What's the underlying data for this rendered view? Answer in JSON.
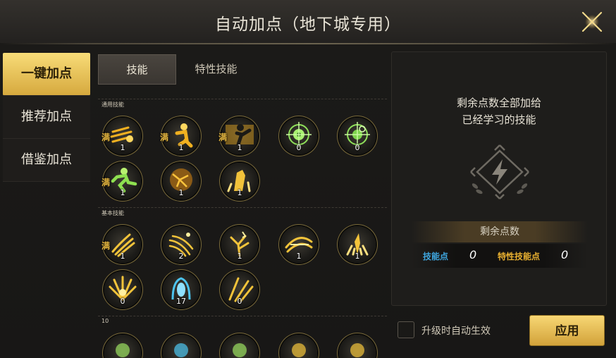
{
  "window": {
    "title": "自动加点（地下城专用）"
  },
  "sidebar": {
    "items": [
      {
        "label": "一键加点",
        "active": true
      },
      {
        "label": "推荐加点",
        "active": false
      },
      {
        "label": "借鉴加点",
        "active": false
      }
    ]
  },
  "tabs": [
    {
      "label": "技能",
      "active": true
    },
    {
      "label": "特性技能",
      "active": false
    }
  ],
  "sections": {
    "common": {
      "title": "通用技能",
      "skills": [
        {
          "icon": "dash-icon",
          "maxed": "满",
          "level": "1"
        },
        {
          "icon": "crouch-icon",
          "maxed": "满",
          "level": "1"
        },
        {
          "icon": "kick-icon",
          "maxed": "满",
          "level": "1"
        },
        {
          "icon": "target-icon",
          "maxed": "",
          "level": "0"
        },
        {
          "icon": "target-swirl-icon",
          "maxed": "",
          "level": "0"
        },
        {
          "icon": "sprint-icon",
          "maxed": "满",
          "level": "1"
        },
        {
          "icon": "cracked-orb-icon",
          "maxed": "",
          "level": "1"
        },
        {
          "icon": "rock-burst-icon",
          "maxed": "",
          "level": "1"
        }
      ]
    },
    "basic": {
      "title": "基本技能",
      "skills": [
        {
          "icon": "claw-slash-icon",
          "maxed": "满",
          "level": "1"
        },
        {
          "icon": "wind-slash-icon",
          "maxed": "",
          "level": "2"
        },
        {
          "icon": "lightning-tree-icon",
          "maxed": "",
          "level": "1"
        },
        {
          "icon": "whirl-slash-icon",
          "maxed": "",
          "level": "1"
        },
        {
          "icon": "flame-burst-icon",
          "maxed": "",
          "level": "1"
        },
        {
          "icon": "explosion-icon",
          "maxed": "",
          "level": "0"
        },
        {
          "icon": "blue-spirit-icon",
          "maxed": "",
          "level": "17"
        },
        {
          "icon": "triple-slash-icon",
          "maxed": "",
          "level": "0"
        }
      ]
    },
    "lv10": {
      "title": "10"
    }
  },
  "right_panel": {
    "description_line1": "剩余点数全部加给",
    "description_line2": "已经学习的技能",
    "emblem_icon": "lightning-emblem-icon",
    "remaining_title": "剩余点数",
    "skill_points_label": "技能点",
    "skill_points_value": "0",
    "trait_points_label": "特性技能点",
    "trait_points_value": "0"
  },
  "footer": {
    "auto_apply_label": "升级时自动生效",
    "auto_apply_checked": false,
    "apply_label": "应用"
  },
  "colors": {
    "accent_gold": "#e8b030",
    "skill_blue": "#3fa7e0",
    "active_tab_gold": "#f0c95a"
  }
}
